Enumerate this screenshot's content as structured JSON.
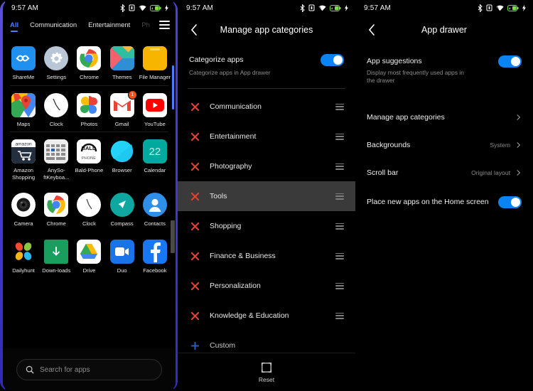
{
  "statusbar": {
    "time": "9:57 AM",
    "icons": [
      "bluetooth-icon",
      "vibrate-icon",
      "wifi-icon",
      "battery-charging-icon",
      "charging-bolt-icon"
    ]
  },
  "panel1": {
    "name": "app-drawer-home",
    "tabs": [
      {
        "label": "All",
        "active": true
      },
      {
        "label": "Communication",
        "active": false
      },
      {
        "label": "Entertainment",
        "active": false
      },
      {
        "label": "Ph",
        "active": false,
        "clipped": true
      }
    ],
    "menu_icon": "hamburger-menu-icon",
    "rows": [
      [
        {
          "label": "ShareMe",
          "icon": "shareme-icon"
        },
        {
          "label": "Settings",
          "icon": "settings-gear-icon"
        },
        {
          "label": "Chrome",
          "icon": "chrome-icon"
        },
        {
          "label": "Themes",
          "icon": "themes-icon"
        },
        {
          "label": "File Manager",
          "icon": "file-manager-icon"
        }
      ],
      [
        {
          "label": "Maps",
          "icon": "google-maps-icon"
        },
        {
          "label": "Clock",
          "icon": "clock-icon"
        },
        {
          "label": "Photos",
          "icon": "google-photos-icon"
        },
        {
          "label": "Gmail",
          "icon": "gmail-icon",
          "badge": "1"
        },
        {
          "label": "YouTube",
          "icon": "youtube-icon"
        }
      ],
      [
        {
          "label": "Amazon Shopping",
          "icon": "amazon-shopping-icon"
        },
        {
          "label": "AnySo-ftKeyboa...",
          "icon": "anysoftkeyboard-icon"
        },
        {
          "label": "Bald-Phone",
          "icon": "baldphone-icon"
        },
        {
          "label": "Browser",
          "icon": "browser-icon"
        },
        {
          "label": "Calendar",
          "icon": "calendar-icon",
          "day": "22"
        }
      ],
      [
        {
          "label": "Camera",
          "icon": "camera-icon"
        },
        {
          "label": "Chrome",
          "icon": "chrome-icon"
        },
        {
          "label": "Clock",
          "icon": "clock-icon"
        },
        {
          "label": "Compass",
          "icon": "compass-icon"
        },
        {
          "label": "Contacts",
          "icon": "contacts-icon"
        }
      ],
      [
        {
          "label": "Dailyhunt",
          "icon": "dailyhunt-icon"
        },
        {
          "label": "Down-loads",
          "icon": "downloads-icon"
        },
        {
          "label": "Drive",
          "icon": "google-drive-icon"
        },
        {
          "label": "Duo",
          "icon": "google-duo-icon"
        },
        {
          "label": "Facebook",
          "icon": "facebook-icon"
        }
      ]
    ],
    "search": {
      "placeholder": "Search for apps",
      "value": "",
      "icon": "search-icon"
    }
  },
  "panel2": {
    "name": "manage-app-categories",
    "title": "Manage app categories",
    "back_icon": "back-chevron-icon",
    "categorize": {
      "title": "Categorize apps",
      "subtitle": "Categorize apps in App drawer",
      "enabled": true
    },
    "categories": [
      {
        "label": "Communication",
        "action": "remove",
        "selected": false
      },
      {
        "label": "Entertainment",
        "action": "remove",
        "selected": false
      },
      {
        "label": "Photography",
        "action": "remove",
        "selected": false
      },
      {
        "label": "Tools",
        "action": "remove",
        "selected": true
      },
      {
        "label": "Shopping",
        "action": "remove",
        "selected": false
      },
      {
        "label": "Finance & Business",
        "action": "remove",
        "selected": false
      },
      {
        "label": "Personalization",
        "action": "remove",
        "selected": false
      },
      {
        "label": "Knowledge & Education",
        "action": "remove",
        "selected": false
      },
      {
        "label": "Custom",
        "action": "add",
        "selected": false
      }
    ],
    "reset": {
      "label": "Reset",
      "icon": "reset-icon"
    }
  },
  "panel3": {
    "name": "app-drawer-settings",
    "title": "App drawer",
    "back_icon": "back-chevron-icon",
    "suggestions": {
      "title": "App suggestions",
      "subtitle": "Display most frequently used apps in the drawer",
      "enabled": true
    },
    "items": [
      {
        "label": "Manage app categories",
        "value": "",
        "type": "link"
      },
      {
        "label": "Backgrounds",
        "value": "System",
        "type": "link"
      },
      {
        "label": "Scroll bar",
        "value": "Original layout",
        "type": "link"
      },
      {
        "label": "Place new apps on the Home screen",
        "value": "",
        "type": "toggle",
        "enabled": true
      }
    ]
  },
  "colors": {
    "accent_blue": "#4c7dfb",
    "toggle_blue": "#0b84f3",
    "remove_red": "#e8402a",
    "add_blue": "#2e6fe0",
    "selected_row": "#3a3a3a"
  }
}
